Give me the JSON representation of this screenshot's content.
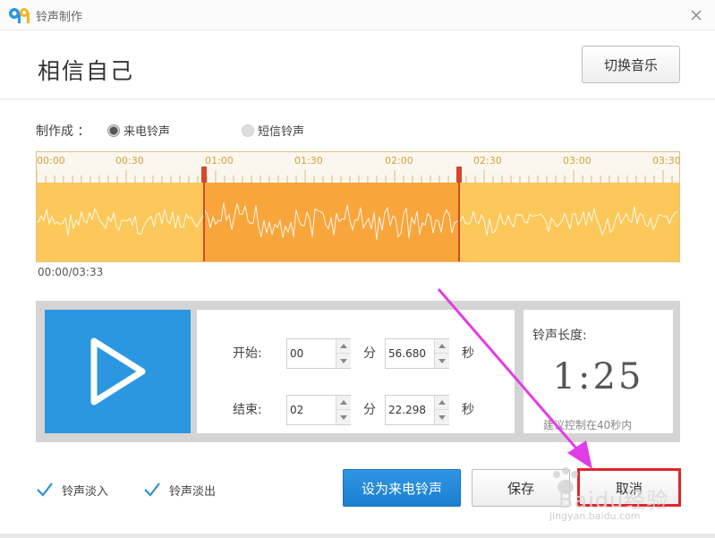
{
  "window": {
    "title": "铃声制作",
    "logo": "app-logo-94",
    "close_icon": "close-icon"
  },
  "song": {
    "title": "相信自己",
    "switch_label": "切换音乐"
  },
  "make_as": {
    "label": "制作成 ：",
    "options": [
      {
        "label": "来电铃声",
        "selected": true
      },
      {
        "label": "短信铃声",
        "selected": false
      }
    ]
  },
  "timeline": {
    "ticks": [
      "00:00",
      "00:30",
      "01:00",
      "01:30",
      "02:00",
      "02:30",
      "03:00",
      "03:30"
    ],
    "total_seconds": 213,
    "selection_start_seconds": 56.68,
    "selection_end_seconds": 142.298,
    "position_readout": "00/00/03:33",
    "colors": {
      "wave_bg": "#fcc85a",
      "selection": "#f8a53b",
      "marker": "#d9452a",
      "tick_text": "#d6a03c"
    }
  },
  "position_readout": "00:00/03:33",
  "editor": {
    "start_label": "开始:",
    "end_label": "结束:",
    "start_min": "00",
    "start_sec": "56.680",
    "end_min": "02",
    "end_sec": "22.298",
    "min_unit": "分",
    "sec_unit": "秒"
  },
  "ringtone_length": {
    "label": "铃声长度:",
    "value": "1:25",
    "hint": "建议控制在40秒内"
  },
  "options": {
    "fade_in": "铃声淡入",
    "fade_out": "铃声淡出",
    "fade_in_checked": true,
    "fade_out_checked": true
  },
  "buttons": {
    "set_ringtone": "设为来电铃声",
    "save": "保存",
    "cancel": "取消"
  },
  "watermark": {
    "text": "Baidu经验",
    "url": "jingyan.baidu.com"
  },
  "accent": {
    "primary_blue": "#2b97e1",
    "highlight_red": "#e0262b",
    "annotation_magenta": "#e23ce8"
  }
}
